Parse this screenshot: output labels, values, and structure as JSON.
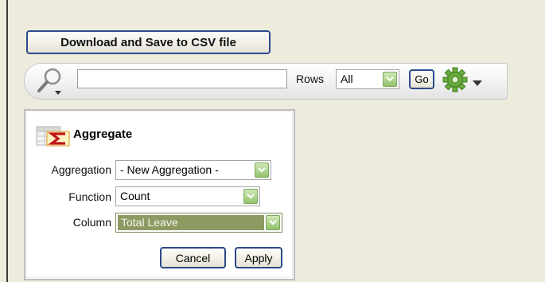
{
  "toolbar": {
    "download_label": "Download and Save to CSV file",
    "search_value": "",
    "rows_label": "Rows",
    "rows_value": "All",
    "go_label": "Go"
  },
  "aggregate_panel": {
    "title": "Aggregate",
    "aggregation_label": "Aggregation",
    "aggregation_value": "- New Aggregation -",
    "function_label": "Function",
    "function_value": "Count",
    "column_label": "Column",
    "column_value": "Total Leave",
    "cancel_label": "Cancel",
    "apply_label": "Apply"
  },
  "colors": {
    "background": "#ecebdc",
    "button_border": "#2b4a8a",
    "dropdown_green": "#93c36e",
    "selected_value_bg": "#8d9a62"
  },
  "icons": [
    "magnifier-icon",
    "dropdown-arrow-icon",
    "gear-icon",
    "sigma-table-icon"
  ]
}
